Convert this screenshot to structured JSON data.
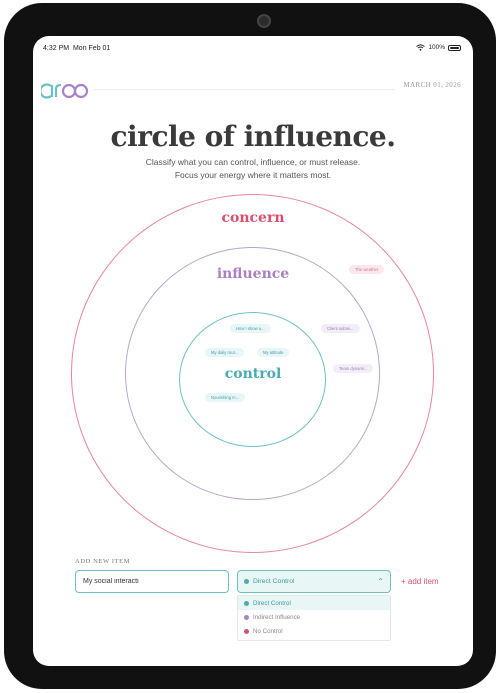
{
  "status_bar": {
    "time": "4:32 PM",
    "date": "Mon Feb 01",
    "battery": "100%"
  },
  "header": {
    "logo_text": "arbo",
    "date": "MARCH 01, 2026"
  },
  "title": "circle of influence.",
  "subtitle_line1": "Classify what you can control, influence, or must release.",
  "subtitle_line2": "Focus your energy where it matters most.",
  "circles": {
    "concern": "concern",
    "influence": "influence",
    "control": "control"
  },
  "chips": {
    "weather": "The weather",
    "client_submit": "Client submi...",
    "team_dynamics": "Team dynami...",
    "how_i_show_up": "How I show u...",
    "my_daily_rout": "My daily rout...",
    "my_attitude": "My attitude",
    "nourishing": "Nourishing m..."
  },
  "form": {
    "label": "ADD NEW ITEM",
    "input_value": "My social interacti",
    "selected": "Direct Control",
    "add_label": "+ add item",
    "options": [
      "Direct Control",
      "Indirect Influence",
      "No Control"
    ]
  },
  "colors": {
    "concern": "#d9506e",
    "influence": "#a882c2",
    "control": "#47acb0"
  }
}
